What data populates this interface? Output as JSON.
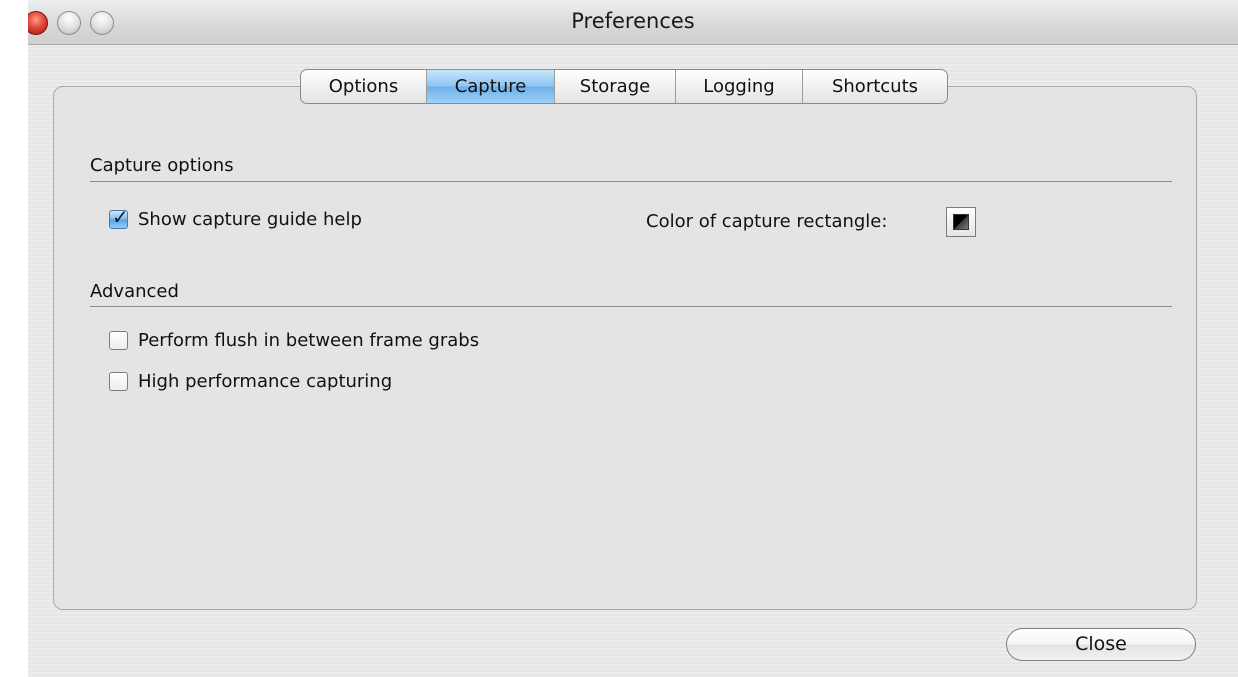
{
  "window": {
    "title": "Preferences"
  },
  "tabs": [
    {
      "label": "Options",
      "active": false
    },
    {
      "label": "Capture",
      "active": true
    },
    {
      "label": "Storage",
      "active": false
    },
    {
      "label": "Logging",
      "active": false
    },
    {
      "label": "Shortcuts",
      "active": false
    }
  ],
  "capture_options": {
    "heading": "Capture options",
    "show_guide": {
      "label": "Show capture guide help",
      "checked": true
    },
    "color_label": "Color of capture rectangle:",
    "color_value": "#000000"
  },
  "advanced": {
    "heading": "Advanced",
    "flush": {
      "label": "Perform flush in between frame grabs",
      "checked": false
    },
    "high_perf": {
      "label": "High performance capturing",
      "checked": false
    }
  },
  "buttons": {
    "close_label": "Close"
  },
  "colors": {
    "active_tab": "#8cc4f1",
    "checkbox_checked": "#7db8ea"
  }
}
